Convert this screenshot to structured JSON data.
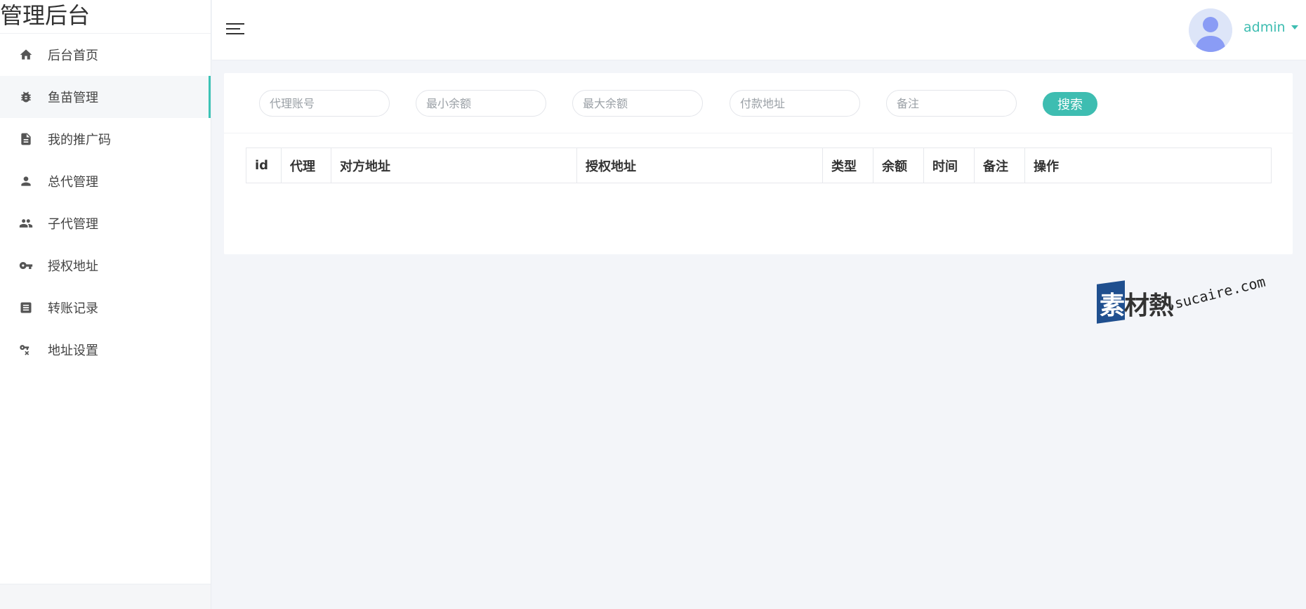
{
  "brand": {
    "title": "管理后台"
  },
  "sidebar": {
    "items": [
      {
        "label": "后台首页",
        "icon": "home-icon",
        "active": false
      },
      {
        "label": "鱼苗管理",
        "icon": "bug-icon",
        "active": true
      },
      {
        "label": "我的推广码",
        "icon": "document-icon",
        "active": false
      },
      {
        "label": "总代管理",
        "icon": "person-icon",
        "active": false
      },
      {
        "label": "子代管理",
        "icon": "people-icon",
        "active": false
      },
      {
        "label": "授权地址",
        "icon": "key-icon",
        "active": false
      },
      {
        "label": "转账记录",
        "icon": "list-box-icon",
        "active": false
      },
      {
        "label": "地址设置",
        "icon": "key-settings-icon",
        "active": false
      }
    ]
  },
  "header": {
    "user_name": "admin",
    "accent_color": "#3ebdb1"
  },
  "filters": {
    "agent_account_placeholder": "代理账号",
    "min_balance_placeholder": "最小余额",
    "max_balance_placeholder": "最大余额",
    "payment_address_placeholder": "付款地址",
    "remark_placeholder": "备注",
    "search_label": "搜索"
  },
  "table": {
    "columns": [
      "id",
      "代理",
      "对方地址",
      "授权地址",
      "类型",
      "余额",
      "时间",
      "备注",
      "操作"
    ]
  },
  "watermark": {
    "zh_first": "素",
    "zh_rest": "材熱",
    "en": "sucaire.com"
  }
}
